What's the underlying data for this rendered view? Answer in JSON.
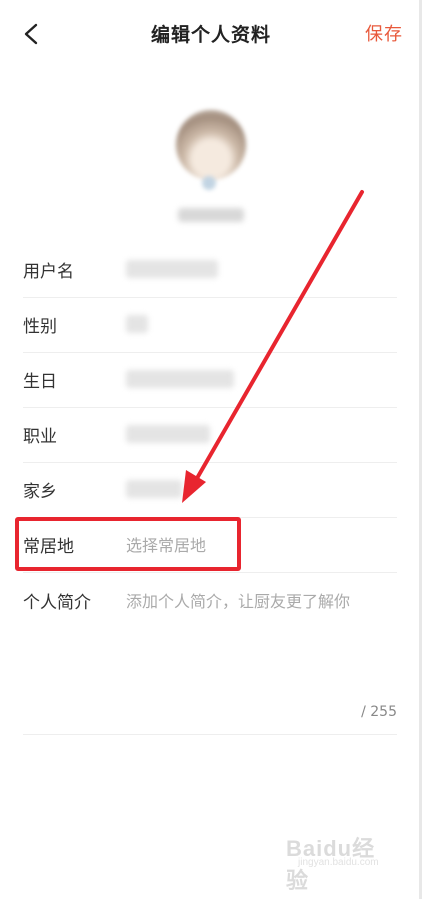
{
  "header": {
    "title": "编辑个人资料",
    "save_label": "保存",
    "back_icon": "chevron-left-icon"
  },
  "form": {
    "fields": [
      {
        "label": "用户名"
      },
      {
        "label": "性别"
      },
      {
        "label": "生日"
      },
      {
        "label": "职业"
      },
      {
        "label": "家乡"
      },
      {
        "label": "常居地",
        "placeholder": "选择常居地"
      }
    ],
    "bio": {
      "label": "个人简介",
      "placeholder": "添加个人简介，让厨友更了解你",
      "counter": "/ 255"
    }
  },
  "annotation": {
    "color": "#e8252f"
  },
  "watermark": {
    "text": "Baidu经验",
    "sub": "jingyan.baidu.com"
  },
  "colors": {
    "accent": "#e8593b",
    "label": "#333333",
    "placeholder": "#aaaaaa"
  }
}
